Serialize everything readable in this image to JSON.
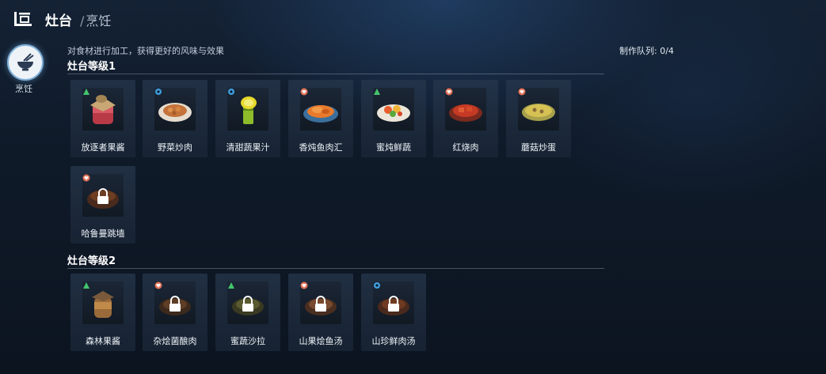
{
  "header": {
    "title": "灶台",
    "subtitle": "烹饪"
  },
  "sidebar": {
    "tab_label": "烹饪"
  },
  "description": "对食材进行加工，获得更好的风味与效果",
  "queue": {
    "label": "制作队列: 0/4"
  },
  "colors": {
    "heart": "#e2735a",
    "leaf": "#43c46b",
    "gear": "#3f9fe0"
  },
  "sections": [
    {
      "title": "灶台等级1",
      "items": [
        {
          "name": "放逐者果酱",
          "badge": "leaf-icon",
          "locked": false
        },
        {
          "name": "野菜炒肉",
          "badge": "gear-icon",
          "locked": false
        },
        {
          "name": "清甜蔬果汁",
          "badge": "gear-icon",
          "locked": false
        },
        {
          "name": "香炖鱼肉汇",
          "badge": "heart-icon",
          "locked": false
        },
        {
          "name": "蜜炖鲜蔬",
          "badge": "leaf-icon",
          "locked": false
        },
        {
          "name": "红烧肉",
          "badge": "heart-icon",
          "locked": false
        },
        {
          "name": "蘑菇炒蛋",
          "badge": "heart-icon",
          "locked": false
        },
        {
          "name": "哈鲁曼跳墙",
          "badge": "heart-icon",
          "locked": true
        }
      ]
    },
    {
      "title": "灶台等级2",
      "items": [
        {
          "name": "森林果酱",
          "badge": "leaf-icon",
          "locked": false
        },
        {
          "name": "杂烩菌酿肉",
          "badge": "heart-icon",
          "locked": true
        },
        {
          "name": "蜜蔬沙拉",
          "badge": "leaf-icon",
          "locked": true
        },
        {
          "name": "山果烩鱼汤",
          "badge": "heart-icon",
          "locked": true
        },
        {
          "name": "山珍鲜肉汤",
          "badge": "gear-icon",
          "locked": true
        }
      ]
    }
  ]
}
